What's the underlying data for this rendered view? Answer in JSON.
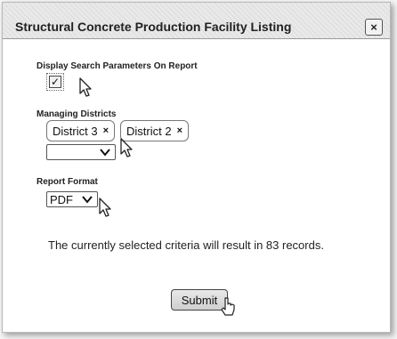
{
  "dialog": {
    "title": "Structural Concrete Production Facility Listing",
    "close_label": "×"
  },
  "search_params": {
    "label": "Display Search Parameters On Report",
    "checked": true,
    "check_glyph": "✓"
  },
  "districts": {
    "label": "Managing Districts",
    "selected": [
      {
        "label": "District 3",
        "remove": "×"
      },
      {
        "label": "District 2",
        "remove": "×"
      }
    ],
    "dropdown_value": ""
  },
  "report_format": {
    "label": "Report Format",
    "value": "PDF"
  },
  "info_text": "The currently selected criteria will result in 83 records.",
  "submit_label": "Submit",
  "icons": {
    "cursor": "pointer-cursor-icon",
    "chevron": "chevron-down-icon",
    "close": "close-icon"
  }
}
